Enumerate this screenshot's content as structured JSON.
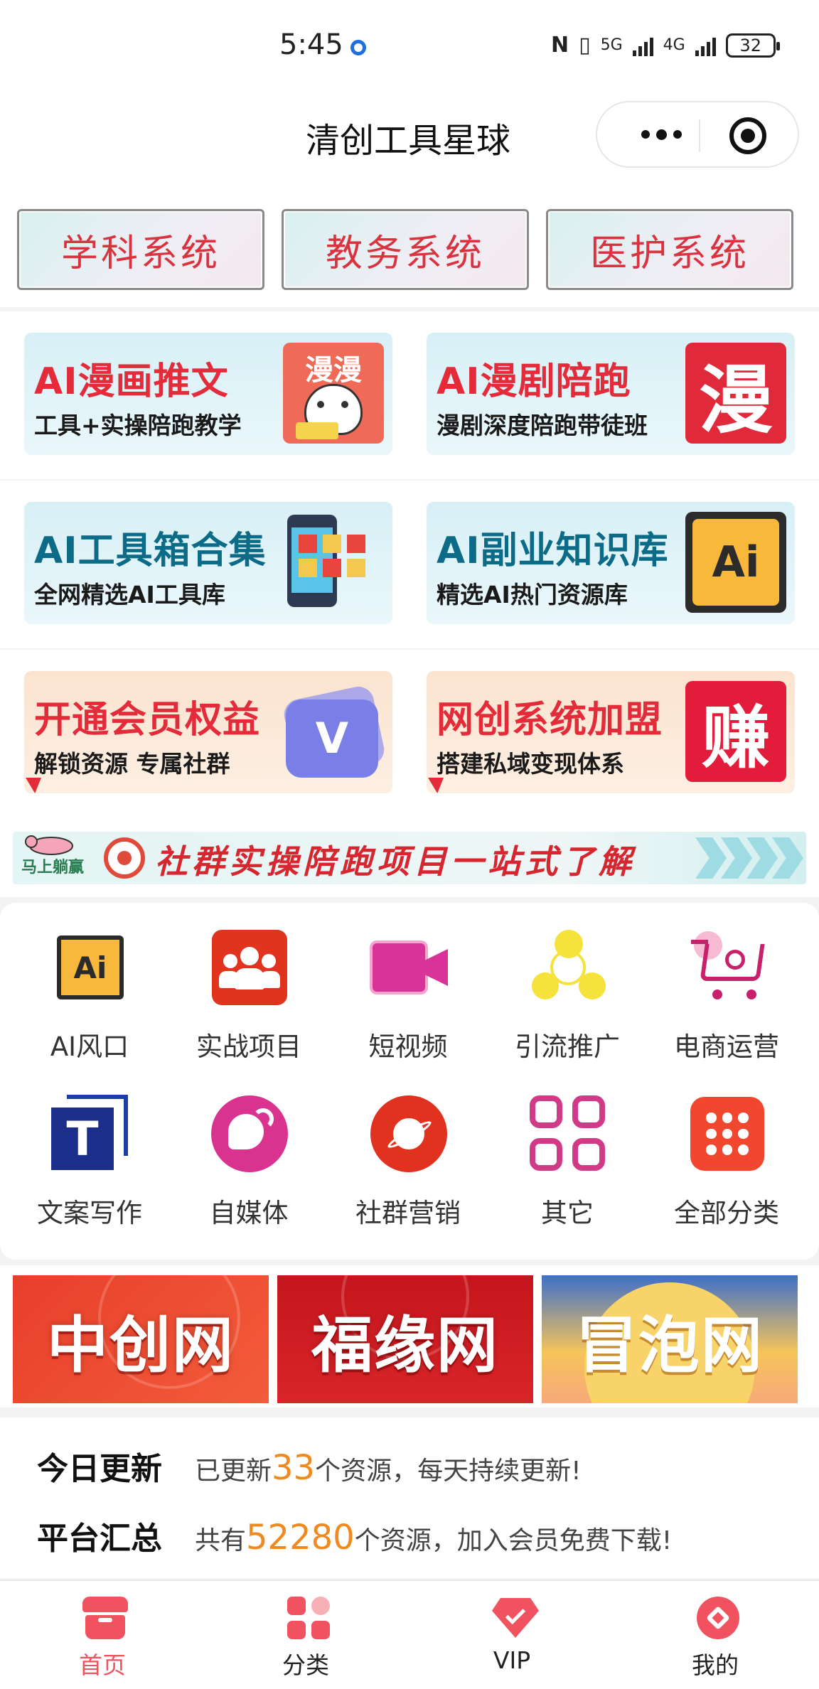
{
  "status_bar": {
    "time": "5:45",
    "net1": "5G",
    "net2": "4G",
    "battery": "32"
  },
  "nav": {
    "title": "清创工具星球"
  },
  "systems": [
    "学科系统",
    "教务系统",
    "医护系统"
  ],
  "feature_cards": [
    {
      "title": "AI漫画推文",
      "subtitle": "工具+实操陪跑教学",
      "icon_text": "漫漫"
    },
    {
      "title": "AI漫剧陪跑",
      "subtitle": "漫剧深度陪跑带徒班",
      "icon_text": "漫"
    },
    {
      "title": "AI工具箱合集",
      "subtitle": "全网精选AI工具库"
    },
    {
      "title": "AI副业知识库",
      "subtitle": "精选AI热门资源库",
      "icon_text": "Ai"
    },
    {
      "title": "开通会员权益",
      "subtitle": "解锁资源 专属社群",
      "icon_text": "V"
    },
    {
      "title": "网创系统加盟",
      "subtitle": "搭建私域变现体系",
      "icon_text": "赚"
    }
  ],
  "banner": {
    "logo": "马上躺赢",
    "text": "社群实操陪跑项目一站式了解"
  },
  "categories": [
    {
      "label": "AI风口",
      "icon": "ai-icon",
      "icon_text": "Ai"
    },
    {
      "label": "实战项目",
      "icon": "people-icon"
    },
    {
      "label": "短视频",
      "icon": "video-camera-icon"
    },
    {
      "label": "引流推广",
      "icon": "share-nodes-icon"
    },
    {
      "label": "电商运营",
      "icon": "shopping-cart-icon"
    },
    {
      "label": "文案写作",
      "icon": "text-icon",
      "icon_text": "T"
    },
    {
      "label": "自媒体",
      "icon": "chat-bubble-icon"
    },
    {
      "label": "社群营销",
      "icon": "planet-icon"
    },
    {
      "label": "其它",
      "icon": "grid-icon"
    },
    {
      "label": "全部分类",
      "icon": "dots-grid-icon"
    }
  ],
  "sites": [
    "中创网",
    "福缘网",
    "冒泡网"
  ],
  "stats": {
    "today": {
      "label": "今日更新",
      "pre": "已更新",
      "num": "33",
      "post": "个资源，每天持续更新!"
    },
    "total": {
      "label": "平台汇总",
      "pre": "共有",
      "num": "52280",
      "post": "个资源，加入会员免费下载!"
    }
  },
  "tabs": [
    {
      "label": "首页",
      "icon": "home-store-icon",
      "active": true
    },
    {
      "label": "分类",
      "icon": "category-icon",
      "active": false
    },
    {
      "label": "VIP",
      "icon": "vip-gem-icon",
      "active": false
    },
    {
      "label": "我的",
      "icon": "profile-icon",
      "active": false
    }
  ],
  "colors": {
    "accent": "#f0525f",
    "title_red": "#e32b3a",
    "title_teal": "#0c6b86",
    "highlight_num": "#f08a1e"
  }
}
